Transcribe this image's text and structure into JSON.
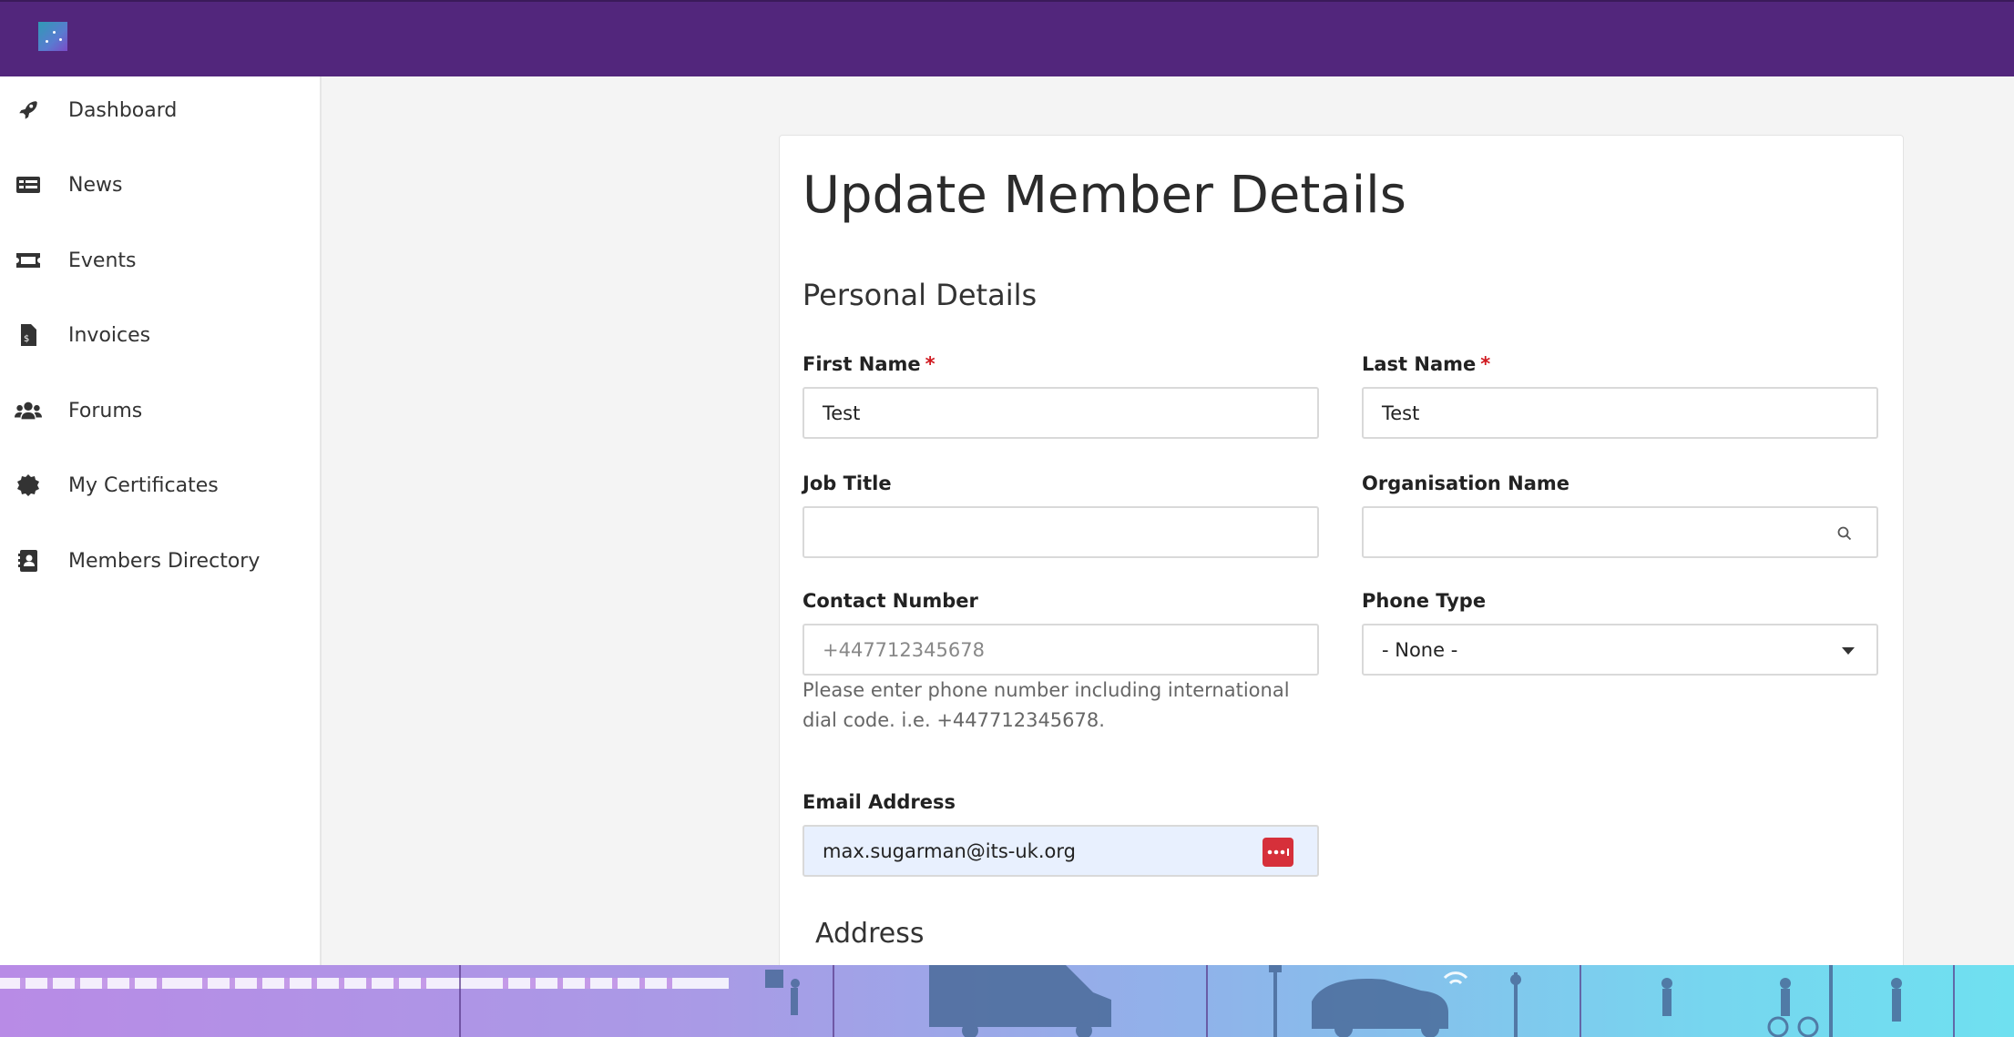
{
  "sidebar": {
    "items": [
      {
        "label": "Dashboard",
        "icon": "rocket-icon"
      },
      {
        "label": "News",
        "icon": "newspaper-icon"
      },
      {
        "label": "Events",
        "icon": "ticket-icon"
      },
      {
        "label": "Invoices",
        "icon": "invoice-icon"
      },
      {
        "label": "Forums",
        "icon": "users-icon"
      },
      {
        "label": "My Certificates",
        "icon": "certificate-icon"
      },
      {
        "label": "Members Directory",
        "icon": "address-book-icon"
      }
    ]
  },
  "form": {
    "title": "Update Member Details",
    "section_personal": "Personal Details",
    "first_name": {
      "label": "First Name",
      "required": "*",
      "value": "Test"
    },
    "last_name": {
      "label": "Last Name",
      "required": "*",
      "value": "Test"
    },
    "job_title": {
      "label": "Job Title",
      "value": ""
    },
    "organisation": {
      "label": "Organisation Name",
      "value": ""
    },
    "contact_number": {
      "label": "Contact Number",
      "placeholder": "+447712345678",
      "help": "Please enter phone number including international dial code. i.e. +447712345678."
    },
    "phone_type": {
      "label": "Phone Type",
      "value": "- None -"
    },
    "email": {
      "label": "Email Address",
      "value": "max.sugarman@its-uk.org"
    },
    "section_address": "Address"
  },
  "colors": {
    "topbar": "#52267c",
    "required": "#d0191f",
    "password_manager": "#d6303a",
    "autofill": "#e8f0fe"
  }
}
